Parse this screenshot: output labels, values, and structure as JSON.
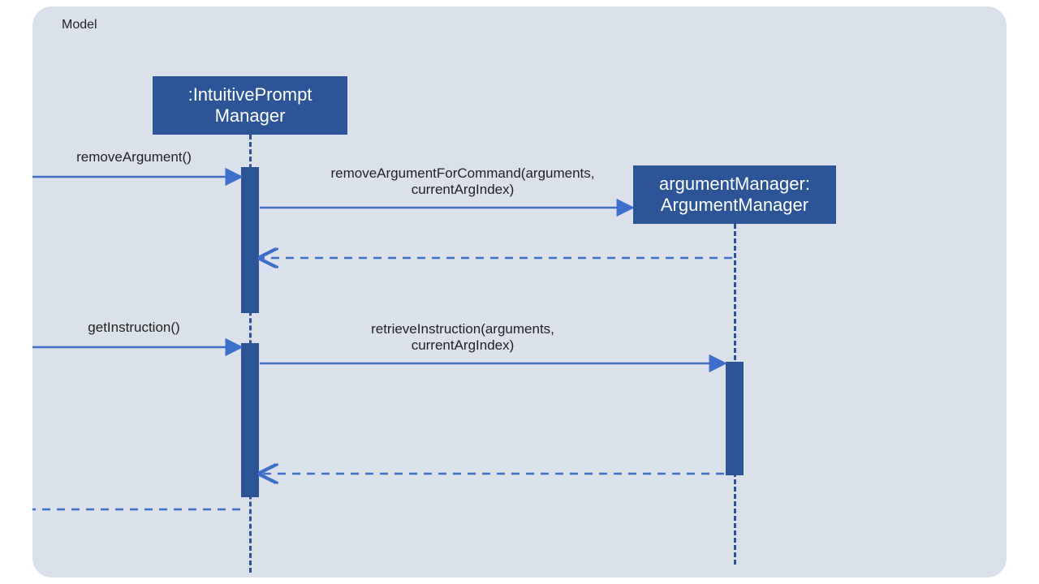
{
  "frame": {
    "title": "Model"
  },
  "participants": {
    "ipm": ":IntuitivePrompt\nManager",
    "am": "argumentManager:\nArgumentManager"
  },
  "messages": {
    "m1": "removeArgument()",
    "m2": "removeArgumentForCommand(arguments,\ncurrentArgIndex)",
    "m3": "getInstruction()",
    "m4": "retrieveInstruction(arguments,\ncurrentArgIndex)"
  },
  "colors": {
    "box": "#2b5597",
    "bg": "#dbe1ea",
    "arrow": "#3b6fc9"
  }
}
